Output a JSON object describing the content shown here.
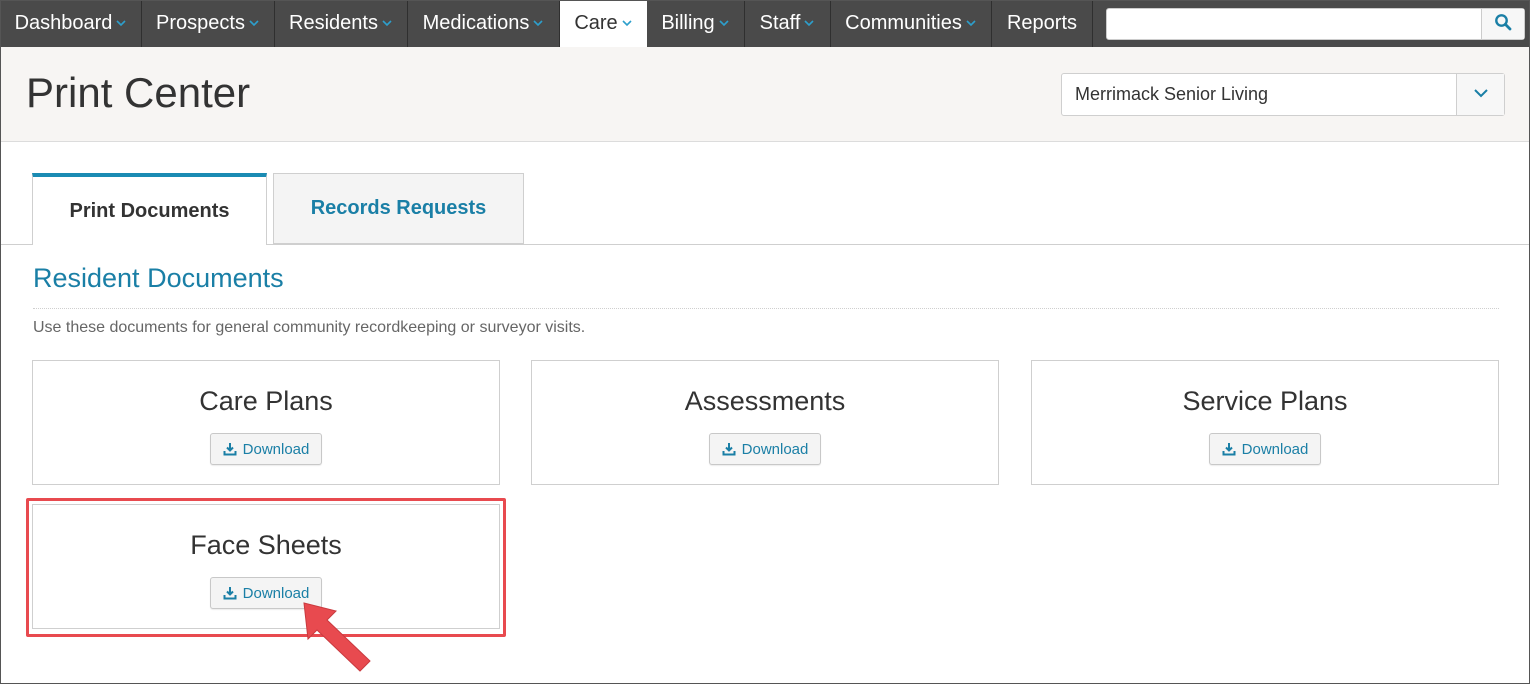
{
  "nav": {
    "items": [
      {
        "label": "Dashboard",
        "dropdown": true
      },
      {
        "label": "Prospects",
        "dropdown": true
      },
      {
        "label": "Residents",
        "dropdown": true
      },
      {
        "label": "Medications",
        "dropdown": true
      },
      {
        "label": "Care",
        "dropdown": true,
        "active": true
      },
      {
        "label": "Billing",
        "dropdown": true
      },
      {
        "label": "Staff",
        "dropdown": true
      },
      {
        "label": "Communities",
        "dropdown": true
      },
      {
        "label": "Reports",
        "dropdown": false
      }
    ],
    "search": {
      "value": "",
      "placeholder": "",
      "icon": "search-icon"
    }
  },
  "header": {
    "title": "Print Center",
    "community_select": {
      "value": "Merrimack Senior Living",
      "icon": "chevron-down-icon"
    }
  },
  "tabs": [
    {
      "label": "Print Documents",
      "active": true
    },
    {
      "label": "Records Requests",
      "active": false
    }
  ],
  "section": {
    "title": "Resident Documents",
    "description": "Use these documents for general community recordkeeping or surveyor visits."
  },
  "cards": [
    {
      "title": "Care Plans",
      "button_label": "Download"
    },
    {
      "title": "Assessments",
      "button_label": "Download"
    },
    {
      "title": "Service Plans",
      "button_label": "Download"
    },
    {
      "title": "Face Sheets",
      "button_label": "Download",
      "highlighted": true
    }
  ],
  "colors": {
    "nav_bg": "#4a4a4a",
    "accent": "#1a7fa6",
    "highlight": "#e84a4f",
    "header_bg": "#f7f5f3"
  }
}
